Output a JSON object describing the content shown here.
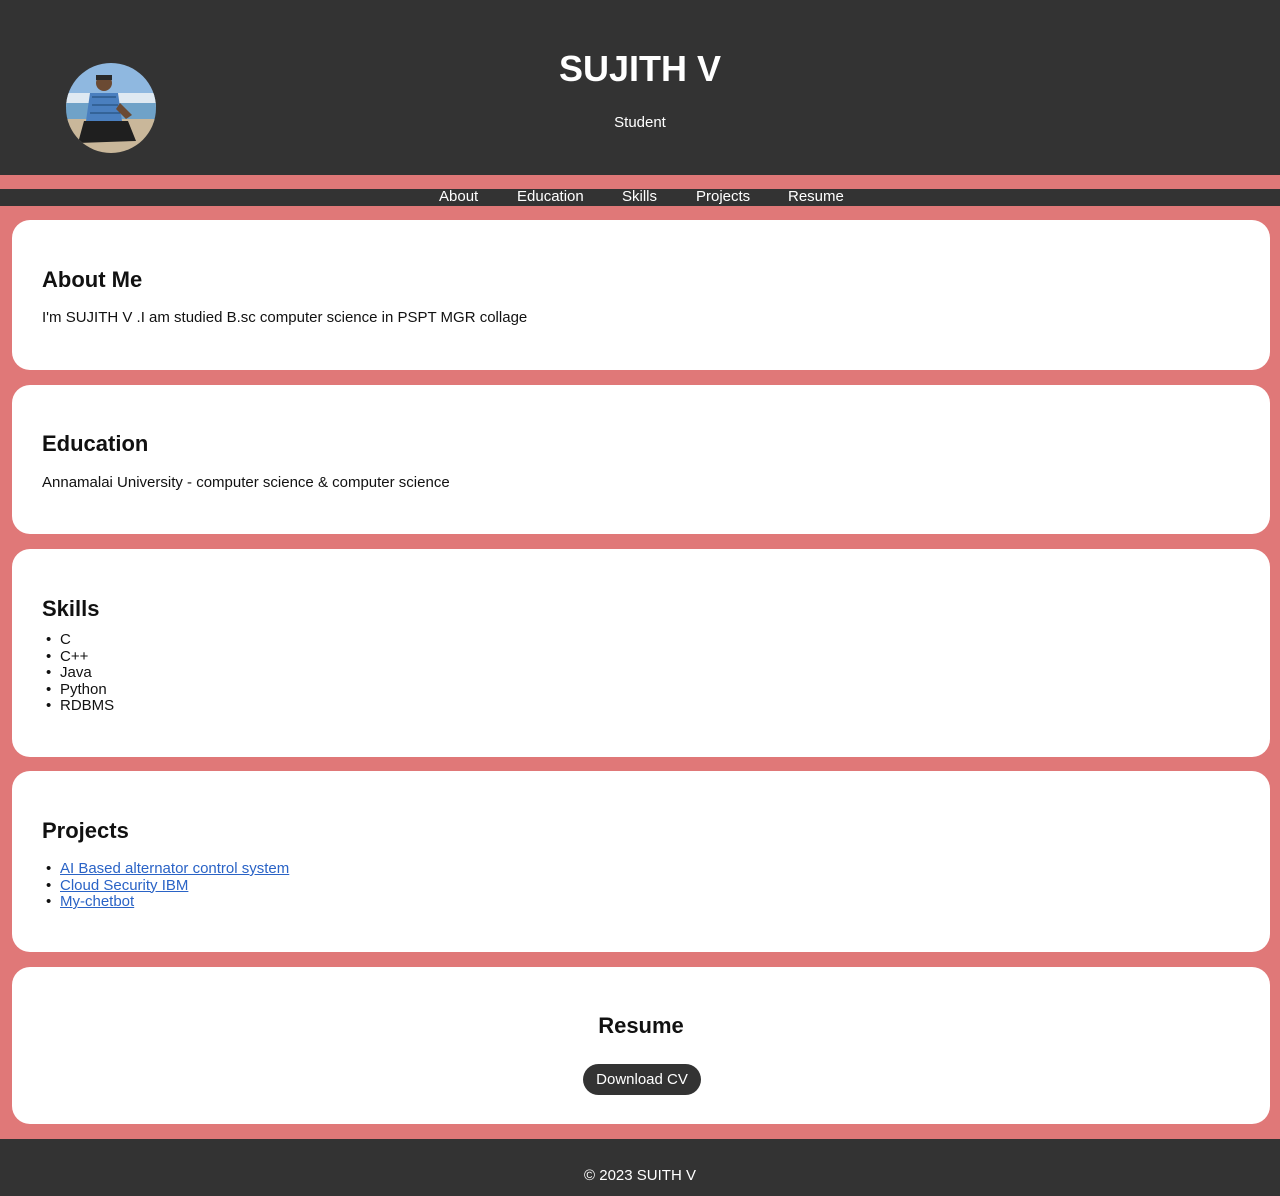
{
  "header": {
    "name": "SUJITH V",
    "subtitle": "Student",
    "avatar_icon": "profile-photo"
  },
  "nav": {
    "items": [
      "About",
      "Education",
      "Skills",
      "Projects",
      "Resume"
    ]
  },
  "about": {
    "title": "About Me",
    "text": "I'm SUJITH V .I am studied B.sc computer science in PSPT MGR collage"
  },
  "education": {
    "title": "Education",
    "text": "Annamalai University - computer science & computer science"
  },
  "skills": {
    "title": "Skills",
    "items": [
      "C",
      "C++",
      "Java",
      "Python",
      "RDBMS"
    ]
  },
  "projects": {
    "title": "Projects",
    "items": [
      "AI Based alternator control system",
      "Cloud Security IBM",
      "My-chetbot"
    ]
  },
  "resume": {
    "title": "Resume",
    "button_label": "Download CV"
  },
  "footer": {
    "text": "© 2023 SUITH V"
  },
  "colors": {
    "header_bg": "#333333",
    "page_bg": "#e07878",
    "card_bg": "#ffffff",
    "link": "#2a63c6"
  }
}
